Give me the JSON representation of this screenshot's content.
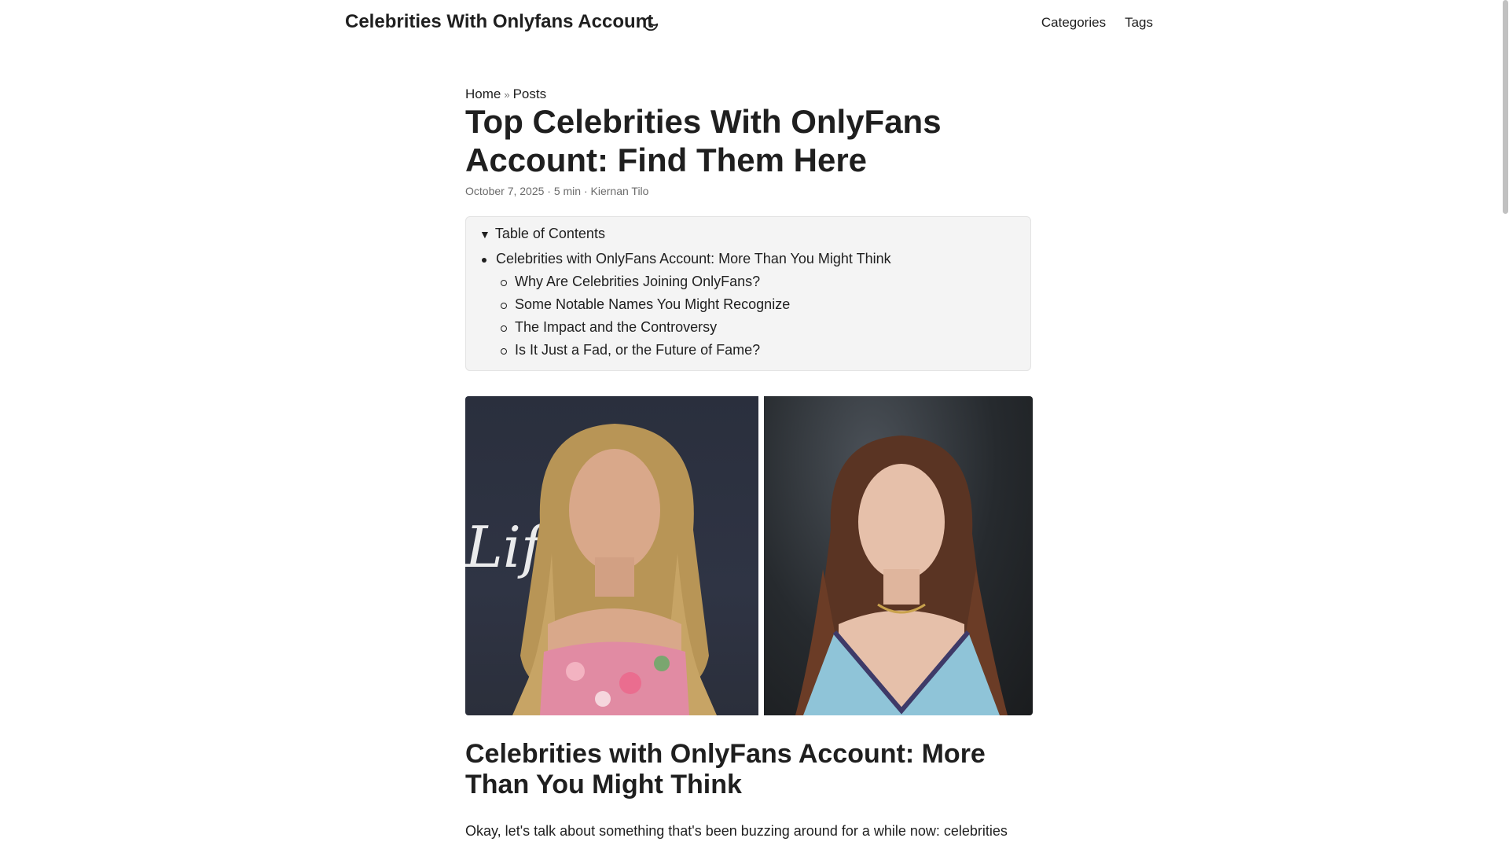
{
  "header": {
    "site_title": "Celebrities With Onlyfans Account",
    "theme_toggle_icon": "moon-icon",
    "nav": [
      {
        "label": "Categories"
      },
      {
        "label": "Tags"
      }
    ]
  },
  "breadcrumb": {
    "home": "Home",
    "separator": "»",
    "posts": "Posts"
  },
  "post": {
    "title": "Top Celebrities With OnlyFans Account: Find Them Here",
    "meta": "October 7, 2025 · 5 min · Kiernan Tilo"
  },
  "toc": {
    "summary": "Table of Contents",
    "items": [
      {
        "label": "Celebrities with OnlyFans Account: More Than You Might Think"
      },
      {
        "label": "Why Are Celebrities Joining OnlyFans?"
      },
      {
        "label": "Some Notable Names You Might Recognize"
      },
      {
        "label": "The Impact and the Controversy"
      },
      {
        "label": "Is It Just a Fad, or the Future of Fame?"
      }
    ]
  },
  "cover": {
    "backdrop_text": "Lifet"
  },
  "content": {
    "section_heading": "Celebrities with OnlyFans Account: More Than You Might Think",
    "paragraph": "Okay, let's talk about something that's been buzzing around for a while now: celebrities"
  },
  "colors": {
    "text": "#1f1f1f",
    "meta": "#6b6b6b",
    "toc_bg": "#f4f4f4"
  }
}
